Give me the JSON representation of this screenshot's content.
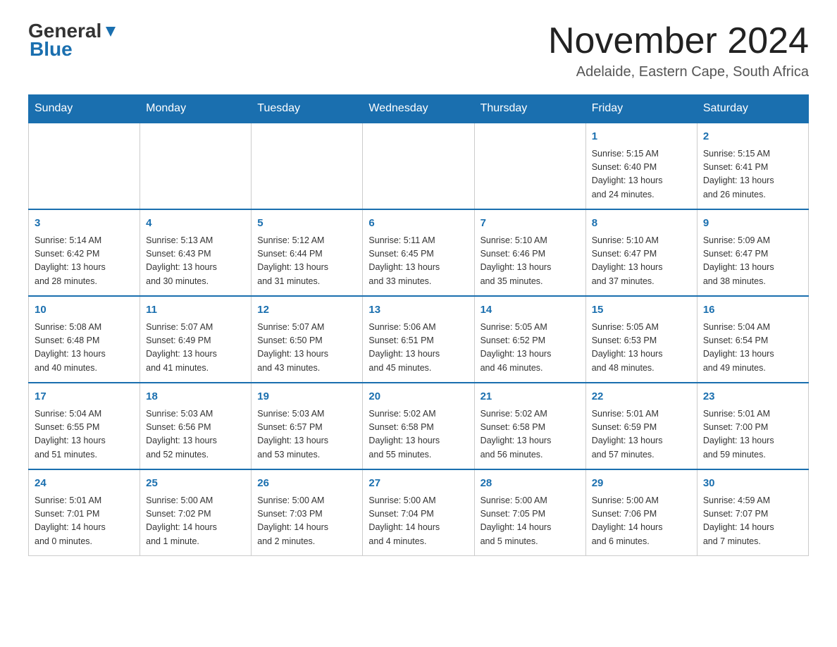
{
  "header": {
    "logo_general": "General",
    "logo_blue": "Blue",
    "month_title": "November 2024",
    "location": "Adelaide, Eastern Cape, South Africa"
  },
  "weekdays": [
    "Sunday",
    "Monday",
    "Tuesday",
    "Wednesday",
    "Thursday",
    "Friday",
    "Saturday"
  ],
  "weeks": [
    [
      {
        "day": "",
        "info": ""
      },
      {
        "day": "",
        "info": ""
      },
      {
        "day": "",
        "info": ""
      },
      {
        "day": "",
        "info": ""
      },
      {
        "day": "",
        "info": ""
      },
      {
        "day": "1",
        "info": "Sunrise: 5:15 AM\nSunset: 6:40 PM\nDaylight: 13 hours\nand 24 minutes."
      },
      {
        "day": "2",
        "info": "Sunrise: 5:15 AM\nSunset: 6:41 PM\nDaylight: 13 hours\nand 26 minutes."
      }
    ],
    [
      {
        "day": "3",
        "info": "Sunrise: 5:14 AM\nSunset: 6:42 PM\nDaylight: 13 hours\nand 28 minutes."
      },
      {
        "day": "4",
        "info": "Sunrise: 5:13 AM\nSunset: 6:43 PM\nDaylight: 13 hours\nand 30 minutes."
      },
      {
        "day": "5",
        "info": "Sunrise: 5:12 AM\nSunset: 6:44 PM\nDaylight: 13 hours\nand 31 minutes."
      },
      {
        "day": "6",
        "info": "Sunrise: 5:11 AM\nSunset: 6:45 PM\nDaylight: 13 hours\nand 33 minutes."
      },
      {
        "day": "7",
        "info": "Sunrise: 5:10 AM\nSunset: 6:46 PM\nDaylight: 13 hours\nand 35 minutes."
      },
      {
        "day": "8",
        "info": "Sunrise: 5:10 AM\nSunset: 6:47 PM\nDaylight: 13 hours\nand 37 minutes."
      },
      {
        "day": "9",
        "info": "Sunrise: 5:09 AM\nSunset: 6:47 PM\nDaylight: 13 hours\nand 38 minutes."
      }
    ],
    [
      {
        "day": "10",
        "info": "Sunrise: 5:08 AM\nSunset: 6:48 PM\nDaylight: 13 hours\nand 40 minutes."
      },
      {
        "day": "11",
        "info": "Sunrise: 5:07 AM\nSunset: 6:49 PM\nDaylight: 13 hours\nand 41 minutes."
      },
      {
        "day": "12",
        "info": "Sunrise: 5:07 AM\nSunset: 6:50 PM\nDaylight: 13 hours\nand 43 minutes."
      },
      {
        "day": "13",
        "info": "Sunrise: 5:06 AM\nSunset: 6:51 PM\nDaylight: 13 hours\nand 45 minutes."
      },
      {
        "day": "14",
        "info": "Sunrise: 5:05 AM\nSunset: 6:52 PM\nDaylight: 13 hours\nand 46 minutes."
      },
      {
        "day": "15",
        "info": "Sunrise: 5:05 AM\nSunset: 6:53 PM\nDaylight: 13 hours\nand 48 minutes."
      },
      {
        "day": "16",
        "info": "Sunrise: 5:04 AM\nSunset: 6:54 PM\nDaylight: 13 hours\nand 49 minutes."
      }
    ],
    [
      {
        "day": "17",
        "info": "Sunrise: 5:04 AM\nSunset: 6:55 PM\nDaylight: 13 hours\nand 51 minutes."
      },
      {
        "day": "18",
        "info": "Sunrise: 5:03 AM\nSunset: 6:56 PM\nDaylight: 13 hours\nand 52 minutes."
      },
      {
        "day": "19",
        "info": "Sunrise: 5:03 AM\nSunset: 6:57 PM\nDaylight: 13 hours\nand 53 minutes."
      },
      {
        "day": "20",
        "info": "Sunrise: 5:02 AM\nSunset: 6:58 PM\nDaylight: 13 hours\nand 55 minutes."
      },
      {
        "day": "21",
        "info": "Sunrise: 5:02 AM\nSunset: 6:58 PM\nDaylight: 13 hours\nand 56 minutes."
      },
      {
        "day": "22",
        "info": "Sunrise: 5:01 AM\nSunset: 6:59 PM\nDaylight: 13 hours\nand 57 minutes."
      },
      {
        "day": "23",
        "info": "Sunrise: 5:01 AM\nSunset: 7:00 PM\nDaylight: 13 hours\nand 59 minutes."
      }
    ],
    [
      {
        "day": "24",
        "info": "Sunrise: 5:01 AM\nSunset: 7:01 PM\nDaylight: 14 hours\nand 0 minutes."
      },
      {
        "day": "25",
        "info": "Sunrise: 5:00 AM\nSunset: 7:02 PM\nDaylight: 14 hours\nand 1 minute."
      },
      {
        "day": "26",
        "info": "Sunrise: 5:00 AM\nSunset: 7:03 PM\nDaylight: 14 hours\nand 2 minutes."
      },
      {
        "day": "27",
        "info": "Sunrise: 5:00 AM\nSunset: 7:04 PM\nDaylight: 14 hours\nand 4 minutes."
      },
      {
        "day": "28",
        "info": "Sunrise: 5:00 AM\nSunset: 7:05 PM\nDaylight: 14 hours\nand 5 minutes."
      },
      {
        "day": "29",
        "info": "Sunrise: 5:00 AM\nSunset: 7:06 PM\nDaylight: 14 hours\nand 6 minutes."
      },
      {
        "day": "30",
        "info": "Sunrise: 4:59 AM\nSunset: 7:07 PM\nDaylight: 14 hours\nand 7 minutes."
      }
    ]
  ]
}
